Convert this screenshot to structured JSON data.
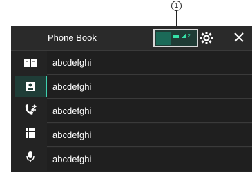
{
  "callout": {
    "number": "1"
  },
  "header": {
    "title": "Phone Book",
    "status_count": "2"
  },
  "sidebar": {
    "items": [
      {
        "icon": "phonebook-icon"
      },
      {
        "icon": "contacts-icon"
      },
      {
        "icon": "call-history-icon"
      },
      {
        "icon": "keypad-icon"
      },
      {
        "icon": "voice-recognition-icon"
      }
    ]
  },
  "list": {
    "rows": [
      {
        "label": "abcdefghi"
      },
      {
        "label": "abcdefghi"
      },
      {
        "label": "abcdefghi"
      },
      {
        "label": "abcdefghi"
      },
      {
        "label": "abcdefghi"
      }
    ]
  },
  "colors": {
    "accent": "#3fd1b0",
    "background": "#232323"
  }
}
